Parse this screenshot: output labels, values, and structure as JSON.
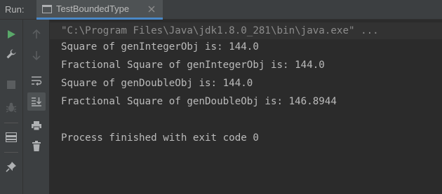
{
  "header": {
    "run_label": "Run:",
    "tab_label": "TestBoundedType"
  },
  "left_icons": [
    "run-icon",
    "wrench-icon",
    "stop-icon",
    "bug-icon",
    "layout-icon",
    "pin-icon"
  ],
  "tool_icons": [
    "up-arrow-icon",
    "down-arrow-icon",
    "soft-wrap-icon",
    "scroll-to-end-icon",
    "print-icon",
    "trash-icon"
  ],
  "console": {
    "command": "\"C:\\Program Files\\Java\\jdk1.8.0_281\\bin\\java.exe\" ...",
    "lines": [
      "Square of genIntegerObj is: 144.0",
      "Fractional Square of genIntegerObj is: 144.0",
      "Square of genDoubleObj is: 144.0",
      "Fractional Square of genDoubleObj is: 146.8944",
      "",
      "Process finished with exit code 0"
    ]
  },
  "colors": {
    "run_green": "#59a869",
    "accent_blue": "#4a88c7",
    "text": "#bbbbbb",
    "command_text": "#8c8c8c"
  }
}
